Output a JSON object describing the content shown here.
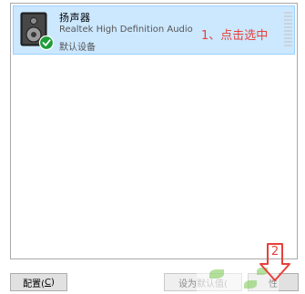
{
  "device": {
    "name": "扬声器",
    "description": "Realtek High Definition Audio",
    "status": "默认设备",
    "icon": "speaker-icon",
    "status_icon": "green-check-icon",
    "selected": true
  },
  "annotations": {
    "step1": "1、点击选中",
    "step2": "2"
  },
  "buttons": {
    "configure_label": "配置(",
    "configure_accel": "C",
    "configure_close": ")",
    "set_default_label": "设为默认值(",
    "properties_label": "性"
  },
  "colors": {
    "selection_bg": "#cce8ff",
    "selection_border": "#99d1ff",
    "annotation_red": "#e8403a",
    "check_green": "#1e9e3a"
  }
}
